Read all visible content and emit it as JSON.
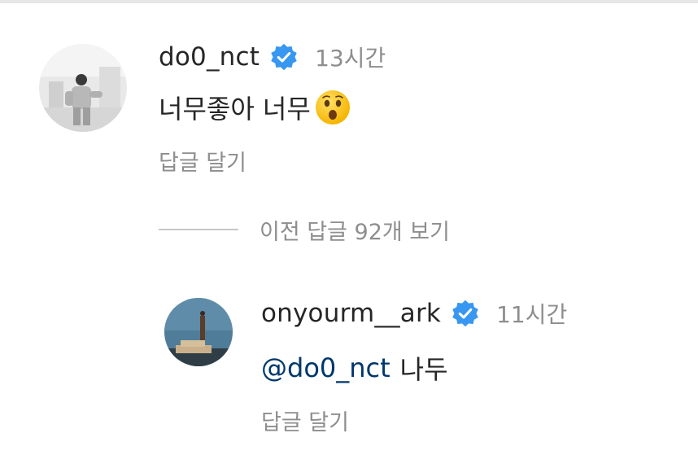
{
  "comments": [
    {
      "username": "do0_nct",
      "time": "13시간",
      "text": "너무좋아 너무",
      "emoji": "astonished-face",
      "reply_label": "답글 달기",
      "verified": true
    }
  ],
  "view_previous_replies": "이전 답글 92개 보기",
  "replies": [
    {
      "username": "onyourm__ark",
      "time": "11시간",
      "mention": "@do0_nct",
      "text": "나두",
      "reply_label": "답글 달기",
      "verified": true
    }
  ],
  "colors": {
    "verified_badge": "#3897f0",
    "mention": "#00376b",
    "secondary_text": "#8e8e8e",
    "primary_text": "#262626"
  }
}
